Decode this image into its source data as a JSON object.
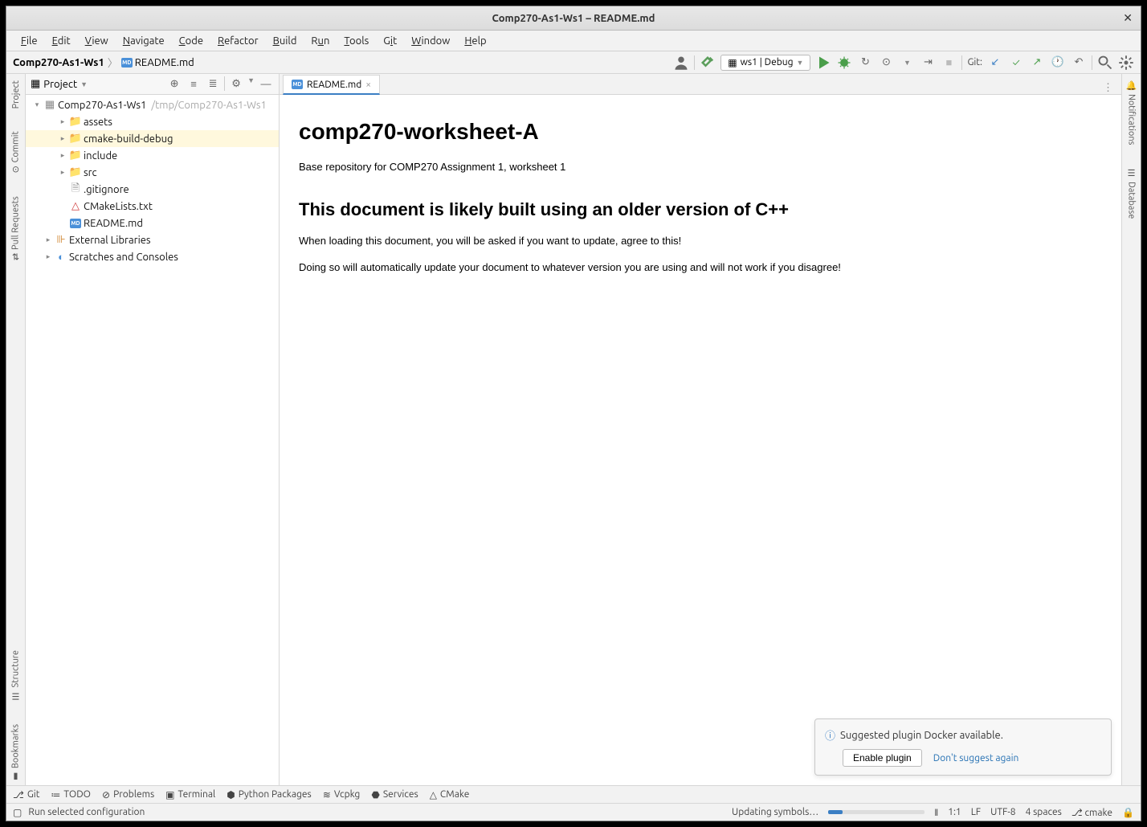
{
  "window": {
    "title": "Comp270-As1-Ws1 – README.md"
  },
  "menubar": {
    "items": [
      "File",
      "Edit",
      "View",
      "Navigate",
      "Code",
      "Refactor",
      "Build",
      "Run",
      "Tools",
      "Git",
      "Window",
      "Help"
    ]
  },
  "breadcrumb": {
    "project": "Comp270-As1-Ws1",
    "file": "README.md"
  },
  "runconfig": {
    "label": "ws1 | Debug"
  },
  "git_label": "Git:",
  "project_panel": {
    "title": "Project",
    "root": {
      "name": "Comp270-As1-Ws1",
      "hint": "/tmp/Comp270-As1-Ws1"
    },
    "children": [
      {
        "name": "assets",
        "type": "folder",
        "expandable": true
      },
      {
        "name": "cmake-build-debug",
        "type": "folder",
        "expandable": true,
        "selected": true,
        "orange": true
      },
      {
        "name": "include",
        "type": "folder",
        "expandable": true
      },
      {
        "name": "src",
        "type": "folder",
        "expandable": true
      },
      {
        "name": ".gitignore",
        "type": "file"
      },
      {
        "name": "CMakeLists.txt",
        "type": "cmake"
      },
      {
        "name": "README.md",
        "type": "md"
      }
    ],
    "external": "External Libraries",
    "scratches": "Scratches and Consoles"
  },
  "left_gutter": [
    "Project",
    "Commit",
    "Pull Requests",
    "Structure",
    "Bookmarks"
  ],
  "right_gutter": [
    "Notifications",
    "Database"
  ],
  "tabs": {
    "active": "README.md"
  },
  "readme": {
    "h1": "comp270-worksheet-A",
    "p1": "Base repository for COMP270 Assignment 1, worksheet 1",
    "h2": "This document is likely built using an older version of C++",
    "p2": "When loading this document, you will be asked if you want to update, agree to this!",
    "p3": "Doing so will automatically update your document to whatever version you are using and will not work if you disagree!"
  },
  "popup": {
    "message": "Suggested plugin Docker available.",
    "button": "Enable plugin",
    "link": "Don't suggest again"
  },
  "bottom_toolbar": [
    "Git",
    "TODO",
    "Problems",
    "Terminal",
    "Python Packages",
    "Vcpkg",
    "Services",
    "CMake"
  ],
  "statusbar": {
    "left": "Run selected configuration",
    "updating": "Updating symbols…",
    "pos": "1:1",
    "enc1": "LF",
    "enc2": "UTF-8",
    "indent": "4 spaces",
    "branch": "cmake"
  }
}
